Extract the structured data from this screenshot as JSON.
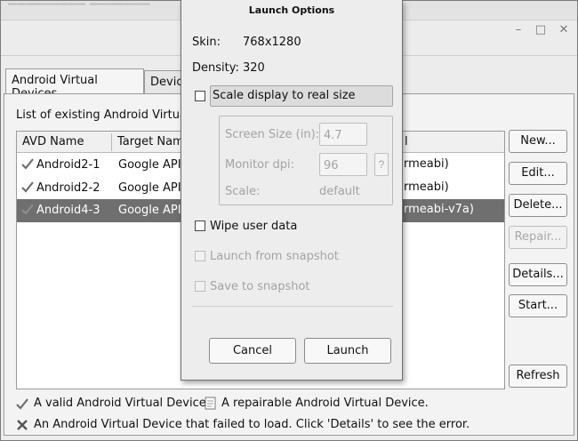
{
  "tabs": [
    {
      "label": "Android Virtual Devices"
    },
    {
      "label": "Devic"
    }
  ],
  "avd_list": {
    "caption": "List of existing Android Virtual",
    "columns": [
      "AVD Name",
      "Target Nam",
      "l"
    ],
    "rows": [
      {
        "name": "Android2-1",
        "target": "Google API",
        "cpu": "rmeabi)",
        "status": "valid",
        "selected": false
      },
      {
        "name": "Android2-2",
        "target": "Google API",
        "cpu": "rmeabi)",
        "status": "valid",
        "selected": false
      },
      {
        "name": "Android4-3",
        "target": "Google API",
        "cpu": "rmeabi-v7a)",
        "status": "valid",
        "selected": true
      }
    ]
  },
  "side_buttons": {
    "new": "New...",
    "edit": "Edit...",
    "delete": "Delete...",
    "repair": "Repair...",
    "details": "Details...",
    "start": "Start...",
    "refresh": "Refresh"
  },
  "legend": {
    "valid": "A valid Android Virtual Device.",
    "repairable": "A repairable Android Virtual Device.",
    "failed": "An Android Virtual Device that failed to load. Click 'Details' to see the error."
  },
  "dialog": {
    "title": "Launch Options",
    "skin_label": "Skin:",
    "skin_value": "768x1280",
    "density_label": "Density:",
    "density_value": "320",
    "scale_label": "Scale display to real size",
    "screen_size_label": "Screen Size (in):",
    "screen_size_value": "4.7",
    "monitor_dpi_label": "Monitor dpi:",
    "monitor_dpi_value": "96",
    "dpi_help": "?",
    "scale_value_label": "Scale:",
    "scale_value": "default",
    "wipe_label": "Wipe user data",
    "launch_snapshot_label": "Launch from snapshot",
    "save_snapshot_label": "Save to snapshot",
    "cancel": "Cancel",
    "launch": "Launch"
  },
  "colors": {
    "selection": "#6f6f6f",
    "check_green": "#6e6e6e",
    "error_x": "#555555"
  }
}
